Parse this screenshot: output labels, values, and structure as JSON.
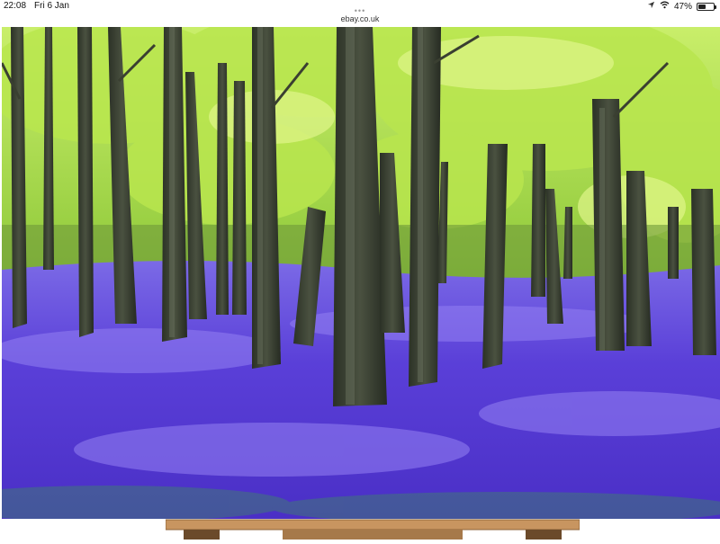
{
  "status_bar": {
    "time": "22:08",
    "date": "Fri 6 Jan",
    "battery_percent": "47%",
    "battery_level": 0.47
  },
  "browser": {
    "url": "ebay.co.uk",
    "more_icon": "three-dots-icon"
  },
  "icons": {
    "location": "location-arrow-icon",
    "wifi": "wifi-icon",
    "battery": "battery-icon"
  },
  "colors": {
    "canopy": "#b5e24a",
    "bluebells": "#5b3fd6",
    "frame": "#c89560"
  }
}
